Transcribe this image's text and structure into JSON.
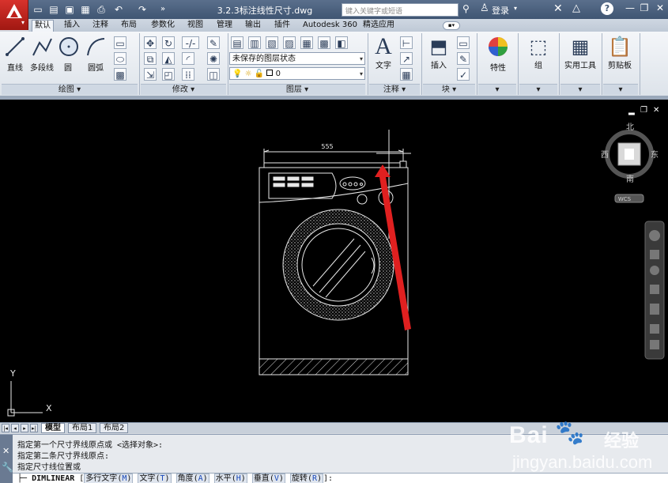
{
  "app": {
    "title": "3.2.3标注线性尺寸.dwg",
    "search_placeholder": "键入关键字或短语",
    "login": "登录"
  },
  "quick_access": [
    "new-icon",
    "open-icon",
    "save-icon",
    "save-as-icon",
    "print-icon",
    "undo-icon",
    "redo-icon"
  ],
  "ribbon_tabs": [
    "默认",
    "插入",
    "注释",
    "布局",
    "参数化",
    "视图",
    "管理",
    "输出",
    "插件",
    "Autodesk 360",
    "精选应用"
  ],
  "panels": {
    "draw": {
      "title": "绘图",
      "line": "直线",
      "polyline": "多段线",
      "circle": "圆",
      "arc": "圆弧"
    },
    "modify": {
      "title": "修改"
    },
    "layer": {
      "title": "图层",
      "state": "未保存的图层状态",
      "current": "0"
    },
    "annotation": {
      "title": "注释",
      "text": "文字"
    },
    "block": {
      "title": "块",
      "insert": "插入"
    },
    "properties": {
      "label": "特性"
    },
    "group": {
      "label": "组"
    },
    "utilities": {
      "label": "实用工具"
    },
    "clipboard": {
      "label": "剪贴板"
    }
  },
  "viewcube": {
    "north": "北",
    "south": "南",
    "east": "东",
    "west": "西",
    "wcs": "WCS"
  },
  "drawing": {
    "dimension_text": "555",
    "ucs_x": "X",
    "ucs_y": "Y"
  },
  "layout_tabs": [
    "模型",
    "布局1",
    "布局2"
  ],
  "command": {
    "history": [
      "指定第一个尺寸界线原点或 <选择对象>:",
      "指定第二条尺寸界线原点:",
      "指定尺寸线位置或"
    ],
    "prompt_cmd": "DIMLINEAR",
    "options": [
      {
        "label": "多行文字",
        "key": "M"
      },
      {
        "label": "文字",
        "key": "T"
      },
      {
        "label": "角度",
        "key": "A"
      },
      {
        "label": "水平",
        "key": "H"
      },
      {
        "label": "垂直",
        "key": "V"
      },
      {
        "label": "旋转",
        "key": "R"
      }
    ],
    "end": "]:"
  },
  "watermark": {
    "brand": "Bai",
    "brand_cn": "经验",
    "site": "jingyan.baidu.com"
  },
  "colors": {
    "titlebar": "#3f5572",
    "logo": "#c0201a",
    "drawing_bg": "#000000",
    "arrow": "#e02020"
  }
}
